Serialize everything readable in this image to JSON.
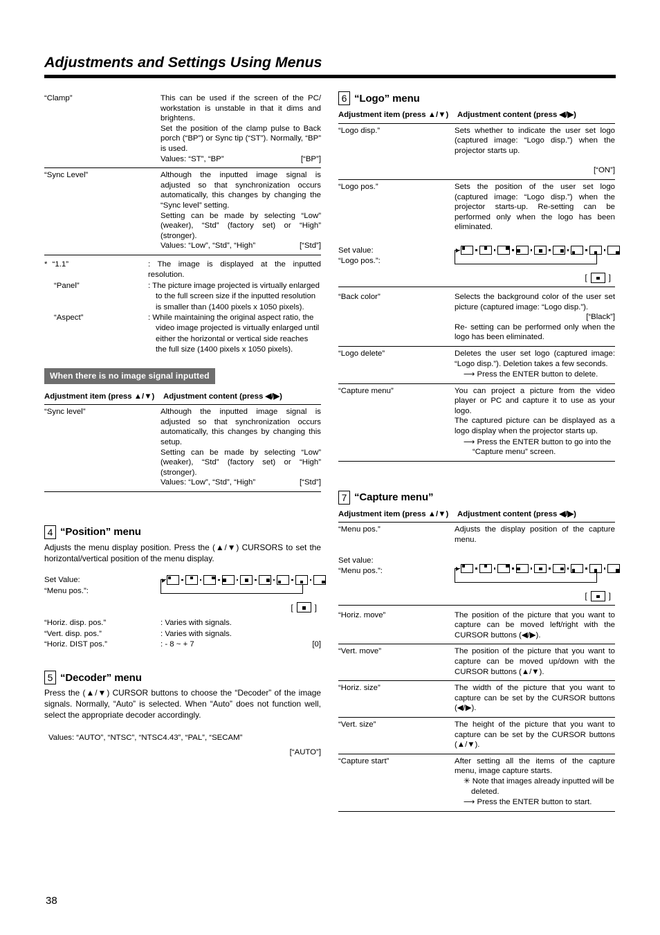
{
  "header": {
    "title": "Adjustments and Settings Using Menus"
  },
  "page_number": "38",
  "table_headers": {
    "item": "Adjustment item (press ▲/▼)",
    "content": "Adjustment content (press ◀/▶)"
  },
  "left_column": {
    "continued_table": {
      "rows": [
        {
          "item": "“Clamp”",
          "paragraphs": [
            "This can be used if the screen of the PC/ workstation is unstable in that it dims and brightens.",
            "Set the position of the clamp pulse to Back porch (“BP”) or Sync tip (“ST”). Normally, “BP” is used."
          ],
          "values_label": "Values: “ST”, “BP”",
          "default": "[“BP”]"
        },
        {
          "item": "“Sync Level”",
          "paragraphs": [
            "Although the inputted image signal is adjusted so that synchronization occurs automatically, this changes by changing the “Sync level” setting.",
            "Setting can be made by selecting “Low” (weaker), “Std” (factory set) or “High” (stronger)."
          ],
          "values_label": "Values: “Low”, “Std”, “High”",
          "default": "[“Std”]"
        }
      ]
    },
    "footnotes": [
      {
        "marker": "*",
        "term": "“1.1”",
        "text": ": The image is displayed at the inputted resolution."
      },
      {
        "marker": "",
        "term": "“Panel”",
        "text": ": The picture image projected is virtually enlarged to the full screen size if the inputted resolution is smaller than (1400 pixels x 1050 pixels)."
      },
      {
        "marker": "",
        "term": "“Aspect”",
        "text": ": While maintaining the original aspect ratio, the video image projected is virtually enlarged until either the horizontal or vertical side reaches the full size (1400 pixels x 1050 pixels)."
      }
    ],
    "no_signal_section": {
      "banner": "When there is no image signal inputted",
      "rows": [
        {
          "item": "“Sync level”",
          "paragraphs": [
            "Although the inputted image signal is adjusted so that synchronization occurs automatically, this changes by changing this setup.",
            "Setting can be made by selecting “Low” (weaker), “Std” (factory set) or “High” (stronger)."
          ],
          "values_label": "Values: “Low”, “Std”, “High”",
          "default": "[“Std”]"
        }
      ]
    },
    "position_menu": {
      "number": "4",
      "title": "“Position” menu",
      "description": "Adjusts the menu display position. Press the (▲/▼) CURSORS to set the horizontal/vertical position of the menu display.",
      "set_value_label_line1": "Set Value:",
      "set_value_label_line2": "“Menu pos.”:",
      "default_open": "[",
      "default_close": "]",
      "rows": [
        {
          "key": "“Horiz. disp. pos.”",
          "value": ": Varies with signals.",
          "tail": ""
        },
        {
          "key": "“Vert. disp. pos.”",
          "value": ": Varies with signals.",
          "tail": ""
        },
        {
          "key": "“Horiz. DIST pos.”",
          "value": ": - 8 ~ + 7",
          "tail": "[0]"
        }
      ]
    },
    "decoder_menu": {
      "number": "5",
      "title": "“Decoder” menu",
      "description": "Press the (▲/▼) CURSOR buttons to choose the “Decoder” of the image signals. Normally, “Auto” is selected. When “Auto” does not function well, select the appropriate decoder accordingly.",
      "values_label": "Values: “AUTO”, “NTSC”, “NTSC4.43”, “PAL”, “SECAM”",
      "default": "[“AUTO”]"
    }
  },
  "right_column": {
    "logo_menu": {
      "number": "6",
      "title": "“Logo” menu",
      "rows": [
        {
          "item": "“Logo disp.”",
          "paragraphs": [
            "Sets whether to indicate the user set logo (captured image: “Logo disp.”) when the projector starts up."
          ],
          "default": "[“ON”]"
        },
        {
          "item": "“Logo pos.”",
          "paragraphs": [
            "Sets the position of the user set logo (captured image: “Logo disp.”) when the projector starts-up. Re-setting can be performed only when the logo has been eliminated."
          ],
          "default": ""
        }
      ],
      "set_value_label_line1": "Set value:",
      "set_value_label_line2": "“Logo pos.”:",
      "default_open": "[",
      "default_close": "]",
      "rows2": [
        {
          "item": "“Back color”",
          "paragraphs": [
            "Selects the background color of the user set picture (captured image: “Logo disp.”)."
          ],
          "default": "[“Black”]",
          "after": "Re- setting can be performed only when the logo has been eliminated."
        },
        {
          "item": "“Logo delete”",
          "paragraphs": [
            "Deletes the user set logo (captured image: “Logo disp.”). Deletion takes a few seconds."
          ],
          "arrow_note": "Press the ENTER button to delete."
        },
        {
          "item": "“Capture menu”",
          "paragraphs": [
            "You can project a picture from the video player or PC and capture it to use as your logo.",
            "The captured picture can be displayed as a logo display when the projector starts up."
          ],
          "arrow_note": "Press the ENTER button to go into the “Capture menu” screen."
        }
      ]
    },
    "capture_menu": {
      "number": "7",
      "title": "“Capture menu”",
      "rows": [
        {
          "item": "“Menu pos.”",
          "paragraphs": [
            "Adjusts the display position of the capture menu."
          ]
        }
      ],
      "set_value_label_line1": "Set value:",
      "set_value_label_line2": "“Menu pos.”:",
      "default_open": "[",
      "default_close": "]",
      "rows2": [
        {
          "item": "“Horiz. move”",
          "paragraphs": [
            "The position of the picture that you want to capture can be moved left/right with the CURSOR buttons (◀/▶)."
          ]
        },
        {
          "item": "“Vert. move”",
          "paragraphs": [
            "The position of the picture that you want to capture can be moved up/down with the CURSOR buttons (▲/▼)."
          ]
        },
        {
          "item": "“Horiz. size”",
          "paragraphs": [
            "The width of the picture that you want to capture can be set by the CURSOR buttons (◀/▶)."
          ]
        },
        {
          "item": "“Vert. size”",
          "paragraphs": [
            "The height of the picture that you want to capture can be set by the CURSOR buttons (▲/▼)."
          ]
        },
        {
          "item": "“Capture start”",
          "paragraphs": [
            "After setting all the items of the capture menu, image capture starts."
          ],
          "star_note": "✳ Note that images already inputted will be deleted.",
          "arrow_note": "Press the ENTER button to start."
        }
      ]
    }
  }
}
